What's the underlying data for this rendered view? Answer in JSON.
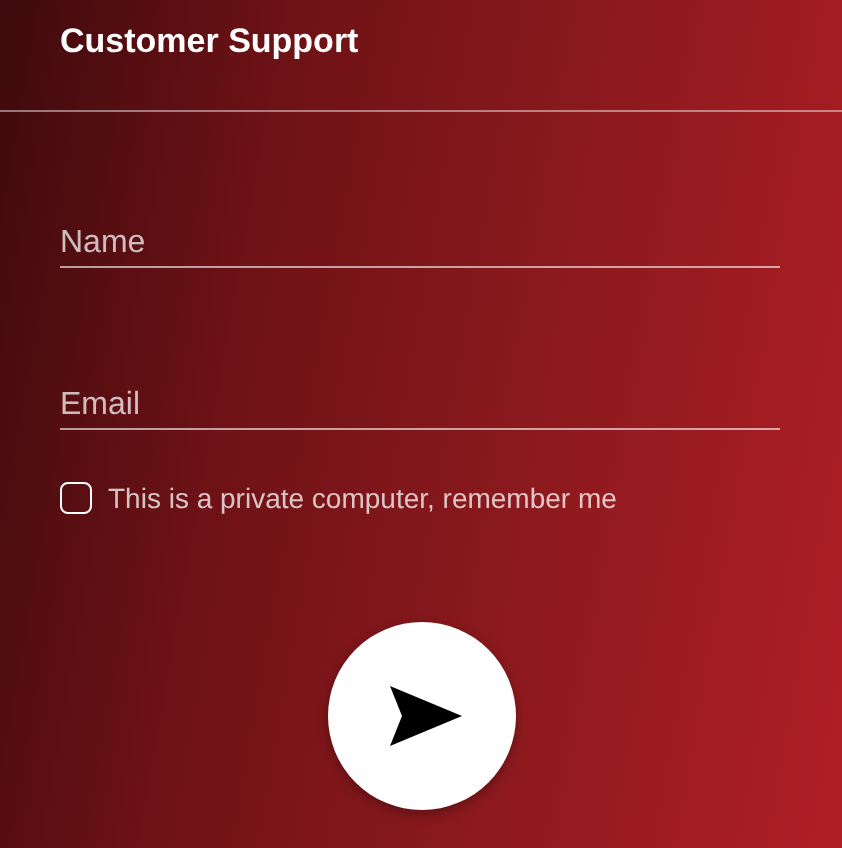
{
  "header": {
    "title": "Customer Support"
  },
  "fields": [
    {
      "placeholder": "Name"
    },
    {
      "placeholder": "Email"
    }
  ],
  "remember": {
    "label": "This is a private computer, remember me",
    "checked": false
  }
}
